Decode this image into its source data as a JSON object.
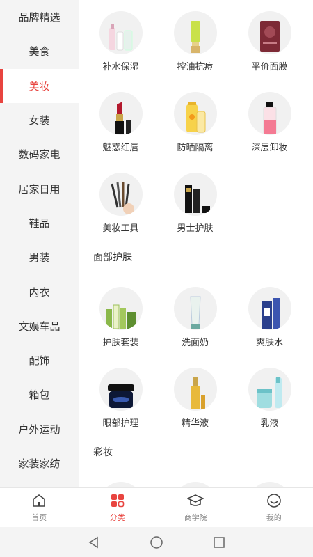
{
  "sidebar": {
    "items": [
      {
        "label": "品牌精选"
      },
      {
        "label": "美食"
      },
      {
        "label": "美妆",
        "active": true
      },
      {
        "label": "女装"
      },
      {
        "label": "数码家电"
      },
      {
        "label": "居家日用"
      },
      {
        "label": "鞋品"
      },
      {
        "label": "男装"
      },
      {
        "label": "内衣"
      },
      {
        "label": "文娱车品"
      },
      {
        "label": "配饰"
      },
      {
        "label": "箱包"
      },
      {
        "label": "户外运动"
      },
      {
        "label": "家装家纺"
      }
    ]
  },
  "main": {
    "group1": [
      {
        "label": "补水保湿",
        "icon": "skincare-bottles-icon"
      },
      {
        "label": "控油抗痘",
        "icon": "green-tube-icon"
      },
      {
        "label": "平价面膜",
        "icon": "face-mask-icon"
      },
      {
        "label": "魅惑红唇",
        "icon": "lipstick-icon"
      },
      {
        "label": "防晒隔离",
        "icon": "sunscreen-icon"
      },
      {
        "label": "深层卸妆",
        "icon": "makeup-remover-icon"
      },
      {
        "label": "美妆工具",
        "icon": "makeup-brushes-icon"
      },
      {
        "label": "男士护肤",
        "icon": "mens-skincare-icon"
      }
    ],
    "section_face": "面部护肤",
    "group2": [
      {
        "label": "护肤套装",
        "icon": "skincare-set-icon"
      },
      {
        "label": "洗面奶",
        "icon": "cleanser-tube-icon"
      },
      {
        "label": "爽肤水",
        "icon": "toner-bottle-icon"
      },
      {
        "label": "眼部护理",
        "icon": "eye-cream-jar-icon"
      },
      {
        "label": "精华液",
        "icon": "serum-bottle-icon"
      },
      {
        "label": "乳液",
        "icon": "lotion-bottles-icon"
      }
    ],
    "section_makeup": "彩妆"
  },
  "tabbar": {
    "items": [
      {
        "label": "首页",
        "icon": "home-icon"
      },
      {
        "label": "分类",
        "icon": "category-icon",
        "active": true
      },
      {
        "label": "商学院",
        "icon": "graduation-cap-icon"
      },
      {
        "label": "我的",
        "icon": "profile-smile-icon"
      }
    ]
  },
  "colors": {
    "accent": "#e8443f",
    "sidebar_bg": "#f4f4f4",
    "icon_circle_bg": "#f1f1f1"
  }
}
